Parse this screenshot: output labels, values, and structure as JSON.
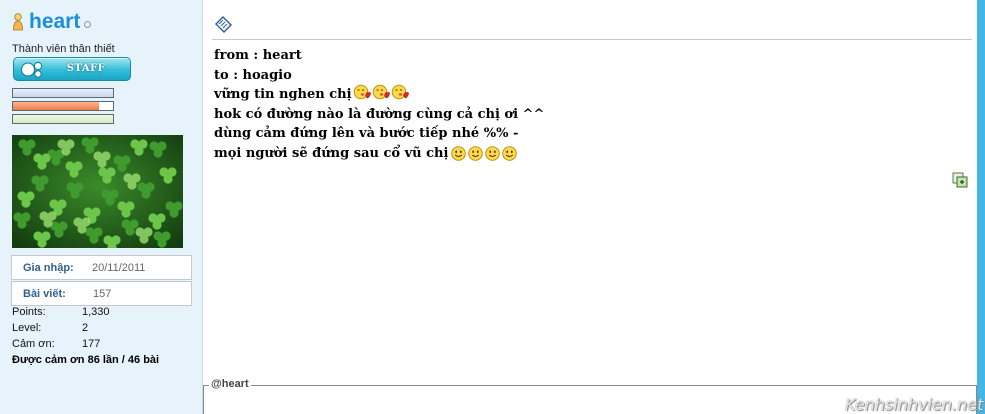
{
  "profile": {
    "username": "heart",
    "rank_title": "Thành viên thân thiết",
    "badge_label": "STAFF",
    "bars": [
      {
        "fraction": 1.0
      },
      {
        "fraction": 0.86
      },
      {
        "fraction": 1.0
      }
    ],
    "join": {
      "label": "Gia nhập:",
      "value": "20/11/2011"
    },
    "posts": {
      "label": "Bài viết:",
      "value": "157"
    },
    "stats": [
      {
        "label": "Points:",
        "value": "1,330"
      },
      {
        "label": "Level:",
        "value": "2"
      },
      {
        "label": "Cảm ơn:",
        "value": "177"
      }
    ],
    "thanks_line": "Được cảm ơn 86 lần / 46 bài",
    "avatar_icon": "clover-photo",
    "online_icon": "offline-status-icon"
  },
  "post": {
    "lines": {
      "from": "from : heart",
      "to": "to : hoagio",
      "l3": "vững tin nghen chị",
      "l4": "hok có đường nào là đường cùng cả chị ơi ^^",
      "l5": "dùng cảm đứng lên và bước tiếp nhé %% -",
      "l6": "mọi người sẽ đứng sau cổ vũ chị"
    },
    "l3_emoticons": 3,
    "l6_emoticons": 4,
    "signature_legend": "@heart"
  },
  "watermark": "Kenhsinhvien.net",
  "colors": {
    "username": "#1e8fd6",
    "sidebar_bg": "#e6f3fb",
    "rail": "#45b6e2",
    "badge": "#33bdd6"
  }
}
